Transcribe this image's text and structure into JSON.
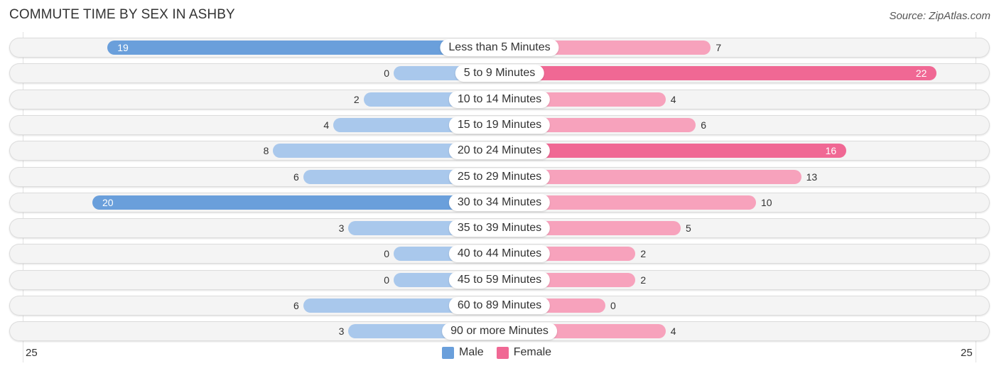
{
  "header": {
    "title": "COMMUTE TIME BY SEX IN ASHBY",
    "source": "Source: ZipAtlas.com"
  },
  "colors": {
    "male": "#6a9fdb",
    "male_light": "#a9c8ec",
    "female": "#f06894",
    "female_light": "#f7a2bc"
  },
  "chart_data": {
    "type": "bar",
    "orientation": "horizontal-diverging",
    "title": "COMMUTE TIME BY SEX IN ASHBY",
    "categories": [
      "Less than 5 Minutes",
      "5 to 9 Minutes",
      "10 to 14 Minutes",
      "15 to 19 Minutes",
      "20 to 24 Minutes",
      "25 to 29 Minutes",
      "30 to 34 Minutes",
      "35 to 39 Minutes",
      "40 to 44 Minutes",
      "45 to 59 Minutes",
      "60 to 89 Minutes",
      "90 or more Minutes"
    ],
    "series": [
      {
        "name": "Male",
        "values": [
          19,
          0,
          2,
          4,
          8,
          6,
          20,
          3,
          0,
          0,
          6,
          3
        ]
      },
      {
        "name": "Female",
        "values": [
          7,
          22,
          4,
          6,
          16,
          13,
          10,
          5,
          2,
          2,
          0,
          4
        ]
      }
    ],
    "axis": {
      "left_tick": "25",
      "right_tick": "25",
      "max": 25
    },
    "legend": {
      "position": "bottom-center",
      "entries": [
        "Male",
        "Female"
      ]
    }
  }
}
